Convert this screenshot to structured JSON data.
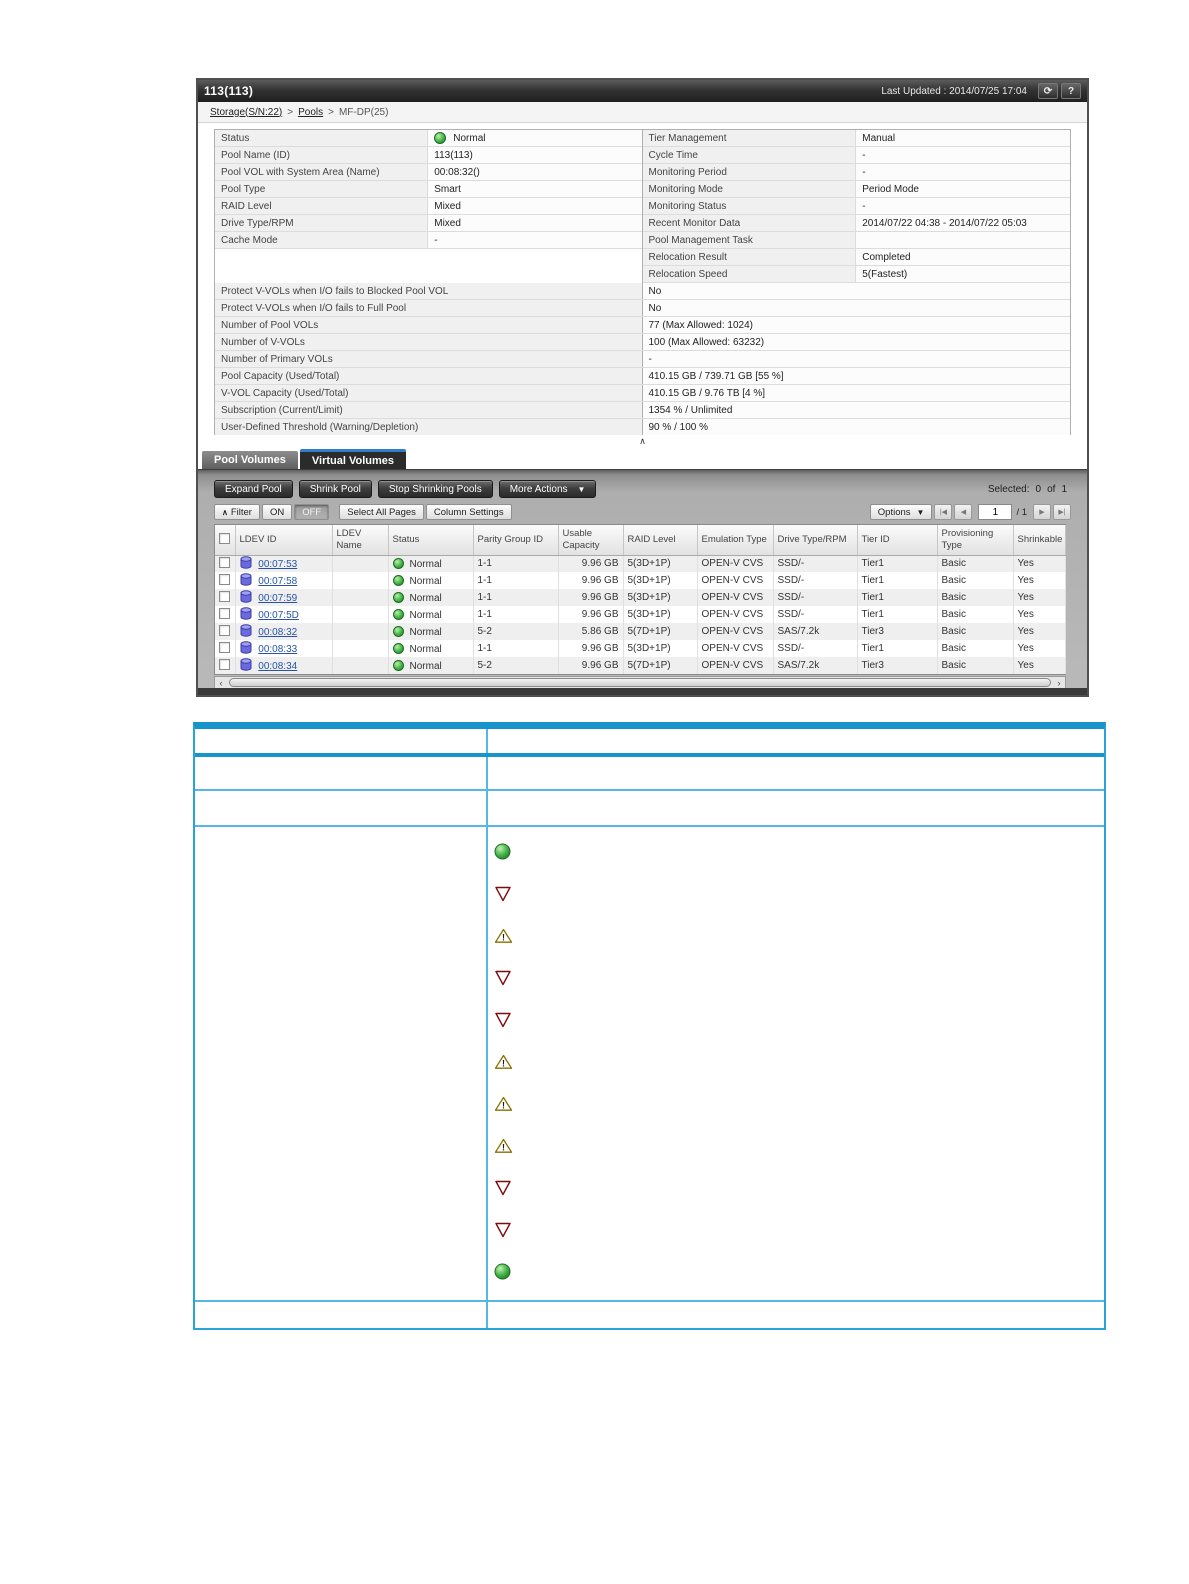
{
  "colors": {
    "doc_table_border": "#1b9cd4",
    "tab_accent": "#2f80c8",
    "link": "#2853a8",
    "status_green": "#3fae49",
    "warning_yellow": "#f5c915",
    "error_red": "#cc2020"
  },
  "window": {
    "title": "113(113)",
    "last_updated": "Last Updated : 2014/07/25 17:04",
    "refresh_icon": "⟳",
    "help_icon": "?",
    "collapse_icon": "∧"
  },
  "breadcrumb": {
    "separator": ">",
    "storage": "Storage(S/N:22)",
    "pools": "Pools",
    "current": "MF-DP(25)"
  },
  "summary": {
    "left": [
      {
        "label": "Status",
        "value": "Normal",
        "icon": "status-normal"
      },
      {
        "label": "Pool Name (ID)",
        "value": "113(113)"
      },
      {
        "label": "Pool VOL with System Area (Name)",
        "value": "00:08:32()"
      },
      {
        "label": "Pool Type",
        "value": "Smart"
      },
      {
        "label": "RAID Level",
        "value": "Mixed"
      },
      {
        "label": "Drive Type/RPM",
        "value": "Mixed"
      },
      {
        "label": "Cache Mode",
        "value": "-"
      }
    ],
    "right": [
      {
        "label": "Tier Management",
        "value": "Manual"
      },
      {
        "label": "Cycle Time",
        "value": "-"
      },
      {
        "label": "Monitoring Period",
        "value": "-"
      },
      {
        "label": "Monitoring Mode",
        "value": "Period Mode"
      },
      {
        "label": "Monitoring Status",
        "value": "-"
      },
      {
        "label": "Recent Monitor Data",
        "value": "2014/07/22 04:38 - 2014/07/22 05:03"
      },
      {
        "label": "Pool Management Task",
        "value": ""
      },
      {
        "label": "Relocation Result",
        "value": "Completed"
      },
      {
        "label": "Relocation Speed",
        "value": "5(Fastest)"
      }
    ],
    "full": [
      {
        "label": "Protect V-VOLs when I/O fails to Blocked Pool VOL",
        "value": "No"
      },
      {
        "label": "Protect V-VOLs when I/O fails to Full Pool",
        "value": "No"
      },
      {
        "label": "Number of Pool VOLs",
        "value": "77 (Max Allowed: 1024)"
      },
      {
        "label": "Number of V-VOLs",
        "value": "100 (Max Allowed: 63232)"
      },
      {
        "label": "Number of Primary VOLs",
        "value": "-"
      },
      {
        "label": "Pool Capacity (Used/Total)",
        "value": "410.15 GB / 739.71 GB [55 %]"
      },
      {
        "label": "V-VOL Capacity (Used/Total)",
        "value": "410.15 GB / 9.76 TB [4 %]"
      },
      {
        "label": "Subscription (Current/Limit)",
        "value": "1354 % / Unlimited"
      },
      {
        "label": "User-Defined Threshold (Warning/Depletion)",
        "value": "90 % / 100 %"
      }
    ]
  },
  "tabs": {
    "pool_volumes": "Pool Volumes",
    "virtual_volumes": "Virtual Volumes"
  },
  "toolbar": {
    "expand_pool": "Expand Pool",
    "shrink_pool": "Shrink Pool",
    "stop_shrinking": "Stop Shrinking Pools",
    "more_actions": "More Actions",
    "dropdown_arrow": "▼",
    "selected_label": "Selected:",
    "selected_count": "0",
    "of_label": "of",
    "total_count": "1"
  },
  "filterbar": {
    "filter_icon": "∧",
    "filter_label": "Filter",
    "on_label": "ON",
    "off_label": "OFF",
    "select_all_pages": "Select All Pages",
    "column_settings": "Column Settings",
    "options_label": "Options",
    "dropdown_arrow": "▼",
    "page_first": "|◀",
    "page_prev": "◀",
    "page_value": "1",
    "page_total": "/ 1",
    "page_next": "▶",
    "page_last": "▶|"
  },
  "volume_table": {
    "columns": [
      "LDEV ID",
      "LDEV Name",
      "Status",
      "Parity Group ID",
      "Usable Capacity",
      "RAID Level",
      "Emulation Type",
      "Drive Type/RPM",
      "Tier ID",
      "Provisioning Type",
      "Shrinkable"
    ],
    "rows": [
      {
        "ldev_id": "00:07:53",
        "ldev_name": "",
        "status": "Normal",
        "parity_group_id": "1-1",
        "usable_capacity": "9.96 GB",
        "raid_level": "5(3D+1P)",
        "emulation_type": "OPEN-V CVS",
        "drive_type_rpm": "SSD/-",
        "tier_id": "Tier1",
        "provisioning_type": "Basic",
        "shrinkable": "Yes"
      },
      {
        "ldev_id": "00:07:58",
        "ldev_name": "",
        "status": "Normal",
        "parity_group_id": "1-1",
        "usable_capacity": "9.96 GB",
        "raid_level": "5(3D+1P)",
        "emulation_type": "OPEN-V CVS",
        "drive_type_rpm": "SSD/-",
        "tier_id": "Tier1",
        "provisioning_type": "Basic",
        "shrinkable": "Yes"
      },
      {
        "ldev_id": "00:07:59",
        "ldev_name": "",
        "status": "Normal",
        "parity_group_id": "1-1",
        "usable_capacity": "9.96 GB",
        "raid_level": "5(3D+1P)",
        "emulation_type": "OPEN-V CVS",
        "drive_type_rpm": "SSD/-",
        "tier_id": "Tier1",
        "provisioning_type": "Basic",
        "shrinkable": "Yes"
      },
      {
        "ldev_id": "00:07:5D",
        "ldev_name": "",
        "status": "Normal",
        "parity_group_id": "1-1",
        "usable_capacity": "9.96 GB",
        "raid_level": "5(3D+1P)",
        "emulation_type": "OPEN-V CVS",
        "drive_type_rpm": "SSD/-",
        "tier_id": "Tier1",
        "provisioning_type": "Basic",
        "shrinkable": "Yes"
      },
      {
        "ldev_id": "00:08:32",
        "ldev_name": "",
        "status": "Normal",
        "parity_group_id": "5-2",
        "usable_capacity": "5.86 GB",
        "raid_level": "5(7D+1P)",
        "emulation_type": "OPEN-V CVS",
        "drive_type_rpm": "SAS/7.2k",
        "tier_id": "Tier3",
        "provisioning_type": "Basic",
        "shrinkable": "Yes"
      },
      {
        "ldev_id": "00:08:33",
        "ldev_name": "",
        "status": "Normal",
        "parity_group_id": "1-1",
        "usable_capacity": "9.96 GB",
        "raid_level": "5(3D+1P)",
        "emulation_type": "OPEN-V CVS",
        "drive_type_rpm": "SSD/-",
        "tier_id": "Tier1",
        "provisioning_type": "Basic",
        "shrinkable": "Yes"
      },
      {
        "ldev_id": "00:08:34",
        "ldev_name": "",
        "status": "Normal",
        "parity_group_id": "5-2",
        "usable_capacity": "9.96 GB",
        "raid_level": "5(7D+1P)",
        "emulation_type": "OPEN-V CVS",
        "drive_type_rpm": "SAS/7.2k",
        "tier_id": "Tier3",
        "provisioning_type": "Basic",
        "shrinkable": "Yes"
      }
    ],
    "scroll_left_icon": "‹",
    "scroll_right_icon": "›"
  },
  "doc_table": {
    "icons": [
      "normal",
      "error",
      "warning",
      "error",
      "error",
      "warning",
      "warning",
      "warning",
      "error",
      "error",
      "normal"
    ]
  }
}
